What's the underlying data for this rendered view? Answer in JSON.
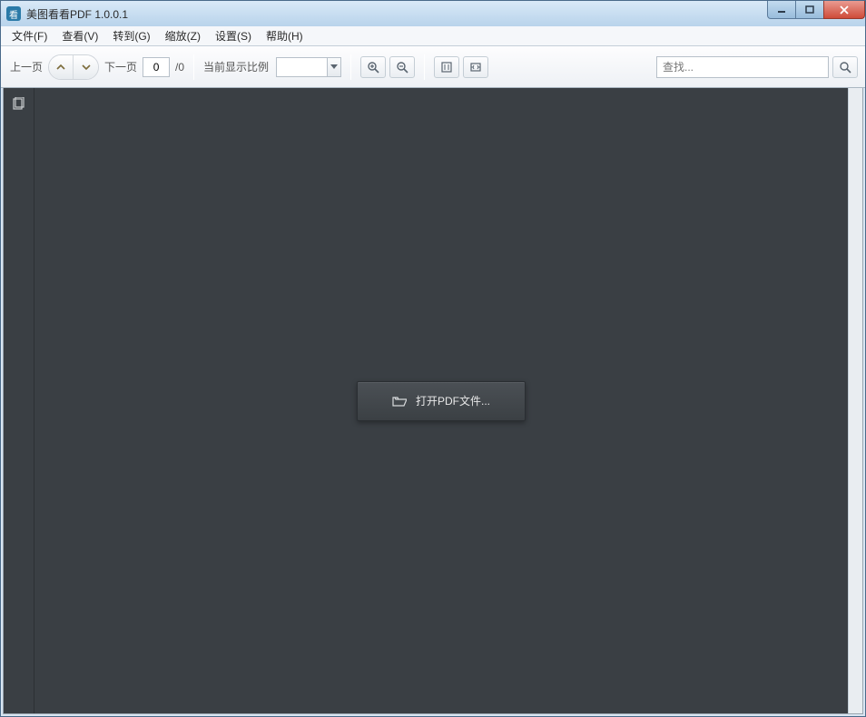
{
  "title": "美图看看PDF 1.0.0.1",
  "menu": {
    "file": "文件(F)",
    "view": "查看(V)",
    "goto": "转到(G)",
    "zoom": "缩放(Z)",
    "settings": "设置(S)",
    "help": "帮助(H)"
  },
  "toolbar": {
    "prev_label": "上一页",
    "next_label": "下一页",
    "page_value": "0",
    "page_total": "/0",
    "zoom_label": "当前显示比例",
    "zoom_value": "",
    "search_placeholder": "查找..."
  },
  "main": {
    "open_button_label": "打开PDF文件..."
  }
}
